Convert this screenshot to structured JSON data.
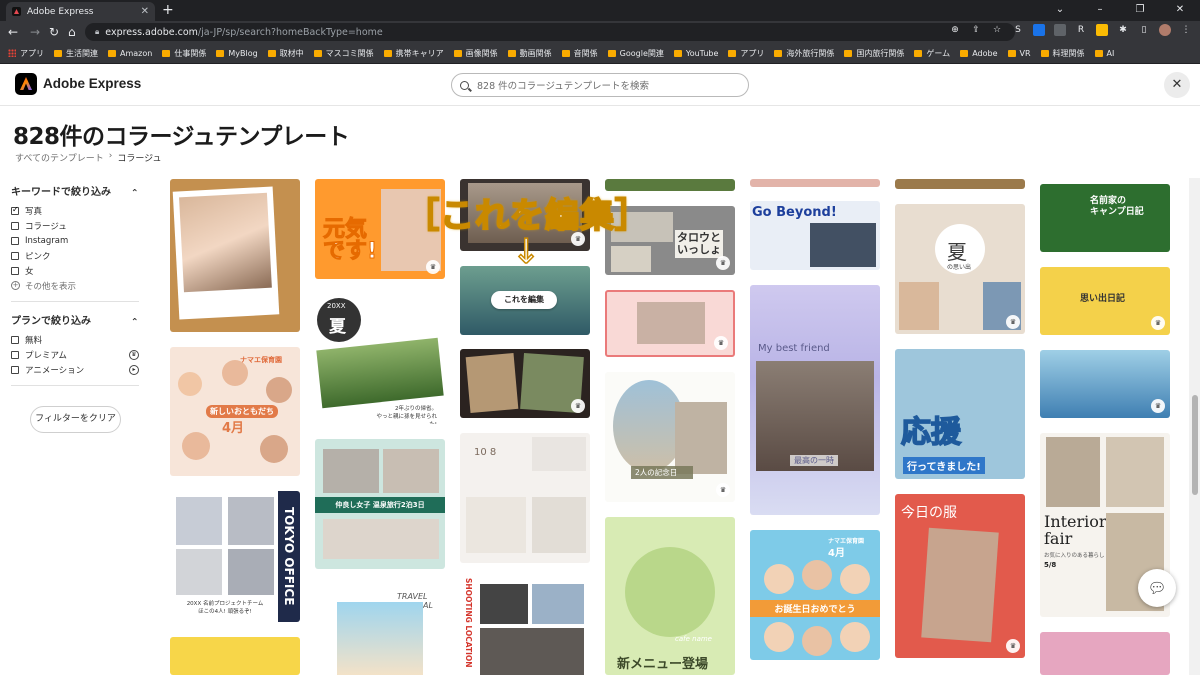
{
  "browser": {
    "tab_title": "Adobe Express",
    "url_host": "express.adobe.com",
    "url_path": "/ja-JP/sp/search?homeBackType=home",
    "bookmarks": [
      "アプリ",
      "生活関連",
      "Amazon",
      "仕事関係",
      "MyBlog",
      "取材中",
      "マスコミ関係",
      "携帯キャリア",
      "画像関係",
      "動画関係",
      "音関係",
      "Google関連",
      "YouTube",
      "アプリ",
      "海外旅行関係",
      "国内旅行関係",
      "ゲーム",
      "Adobe",
      "VR",
      "料理関係",
      "AI"
    ]
  },
  "header": {
    "app_name": "Adobe Express",
    "search_placeholder": "828 件のコラージュテンプレートを検索"
  },
  "page": {
    "title": "828件のコラージュテンプレート",
    "breadcrumb": [
      "すべてのテンプレート",
      "コラージュ"
    ]
  },
  "filters": {
    "keyword_title": "キーワードで絞り込み",
    "keywords": [
      {
        "label": "写真",
        "checked": true
      },
      {
        "label": "コラージュ",
        "checked": false
      },
      {
        "label": "Instagram",
        "checked": false
      },
      {
        "label": "ピンク",
        "checked": false
      },
      {
        "label": "女",
        "checked": false
      }
    ],
    "show_more": "その他を表示",
    "plan_title": "プランで絞り込み",
    "plans": [
      {
        "label": "無料",
        "checked": false
      },
      {
        "label": "プレミアム",
        "checked": false
      },
      {
        "label": "アニメーション",
        "checked": false
      }
    ],
    "clear_label": "フィルターをクリア"
  },
  "overlay": {
    "note": "［これを編集］",
    "arrow": "↓",
    "edit_button": "これを編集"
  },
  "cards": {
    "genki": "元気\nです!",
    "summer_year": "20XX",
    "summer_kanji": "夏",
    "summer_caption": "2年ぶりの帰省。\nやっと親に孫を見せられた!",
    "tokyo_office": "TOKYO OFFICE",
    "team_caption": "20XX 名前プロジェクトチーム\nほこの4人! 頑張るぞ!",
    "new_friends": "新しいおともだち",
    "april": "4月",
    "nursery": "ナマエ保育園",
    "onsen": "仲良し女子 温泉旅行2泊3日",
    "travel_journal": "TRAVEL\nJOURNAL",
    "omoide": "の思い出",
    "taro": "タロウと\nいっしょ",
    "anniversary": "2人の記念日",
    "baby_numbers": "10 8",
    "shooting": "SHOOTING LOCATION",
    "new_menu": "新メニュー登場",
    "cafe_name": "cafe name",
    "go_beyond": "Go Beyond!",
    "best_friend": "My best friend",
    "best_moment": "最高の一時",
    "birthday": "お誕生日おめでとう",
    "birthday_month": "4月",
    "natsu": "夏",
    "natsu_sub": "の思い出",
    "ouen": "応援",
    "ittekimashita": "行ってきました!",
    "kyou_no_fuku": "今日の服",
    "camp": "名前家の\nキャンプ日記",
    "trip_diary": "思い出日記",
    "interior": "Interior\nfair",
    "interior_sub": "お気に入りのある暮らし",
    "interior_date": "5/8"
  }
}
